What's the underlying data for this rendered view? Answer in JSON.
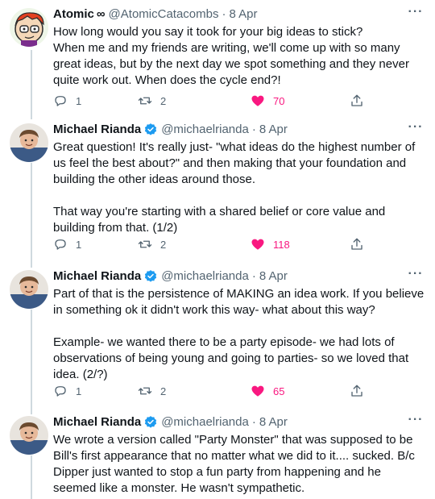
{
  "colors": {
    "text": "#0f1419",
    "secondary": "#536471",
    "like": "#f91880",
    "verified": "#1d9bf0",
    "thread_line": "#cfd9de"
  },
  "tweets": [
    {
      "name": "Atomic",
      "name_suffix": "∞",
      "handle": "@AtomicCatacombs",
      "separator": "·",
      "date": "8 Apr",
      "verified": false,
      "text": "How long would you say it took for your big ideas to stick?\nWhen me and my friends are writing, we'll come up with so many great ideas, but by the next day we spot something and they never quite work out. When does the cycle end?!",
      "replies": "1",
      "retweets": "2",
      "likes": "70",
      "more_label": "···"
    },
    {
      "name": "Michael Rianda",
      "handle": "@michaelrianda",
      "separator": "·",
      "date": "8 Apr",
      "verified": true,
      "text": "Great question! It's really just- \"what ideas do the highest number of us feel the best about?\" and then making that your foundation and building the other ideas around those.\n\nThat way you're starting with a shared belief or core value and building from that. (1/2)",
      "replies": "1",
      "retweets": "2",
      "likes": "118",
      "more_label": "···"
    },
    {
      "name": "Michael Rianda",
      "handle": "@michaelrianda",
      "separator": "·",
      "date": "8 Apr",
      "verified": true,
      "text": "Part of that is the persistence of MAKING an idea work. If you believe in something ok it didn't work this way- what about this way?\n\nExample- we wanted there to be a party episode- we had lots of observations of being young and going to parties- so we loved that idea. (2/?)",
      "replies": "1",
      "retweets": "2",
      "likes": "65",
      "more_label": "···"
    },
    {
      "name": "Michael Rianda",
      "handle": "@michaelrianda",
      "separator": "·",
      "date": "8 Apr",
      "verified": true,
      "text": "We wrote a version called \"Party Monster\" that was supposed to be Bill's first appearance that no matter what we did to it.... sucked. B/c Dipper just wanted to stop a fun party from happening and he seemed like a monster. He wasn't sympathetic.",
      "more_label": "···"
    }
  ]
}
